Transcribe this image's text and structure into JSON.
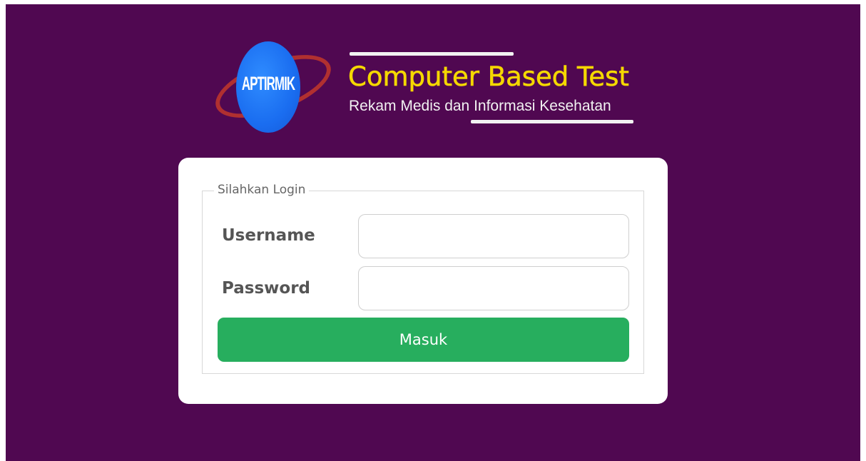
{
  "header": {
    "logo_text": "APTIRMIK",
    "title": "Computer Based Test",
    "subtitle": "Rekam Medis dan Informasi Kesehatan"
  },
  "login": {
    "legend": "Silahkan Login",
    "username_label": "Username",
    "username_value": "",
    "password_label": "Password",
    "password_value": "",
    "submit_label": "Masuk"
  },
  "colors": {
    "background": "#500851",
    "title": "#f5d800",
    "button": "#27ae5e",
    "logo_circle": "#1a6df0",
    "logo_ring": "#b03030"
  }
}
